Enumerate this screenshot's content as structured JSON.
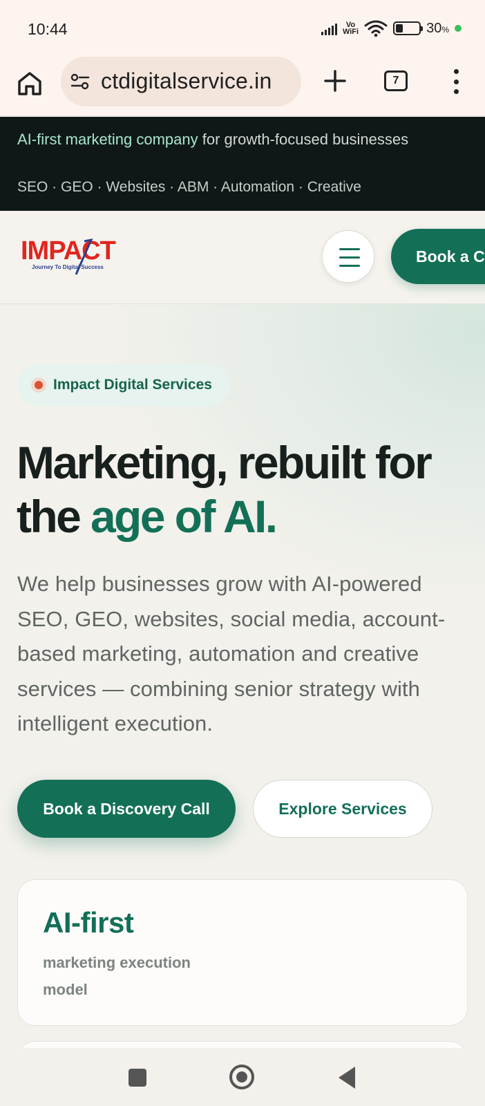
{
  "status_bar": {
    "time": "10:44",
    "network_label_top": "Vo",
    "network_label_bottom": "WiFi",
    "battery_percent": "30",
    "battery_unit": "%",
    "battery_level": 0.3
  },
  "browser": {
    "url": "ctdigitalservice.in",
    "tab_count": "7",
    "icons": [
      "home-icon",
      "site-settings-icon",
      "new-tab-icon",
      "tab-switcher-icon",
      "more-menu-icon"
    ]
  },
  "banner": {
    "highlight": "AI-first marketing company",
    "rest": " for growth-focused businesses",
    "services_line": "SEO · GEO · Websites · ABM · Automation · Creative"
  },
  "header": {
    "logo_text": "IMPACT",
    "logo_tagline": "Journey To Digital Success",
    "cta_label": "Book a Call",
    "menu_icon": "hamburger-icon"
  },
  "hero": {
    "chip_label": "Impact Digital Services",
    "title_part1": "Marketing, rebuilt for the ",
    "title_accent": "age of AI.",
    "description": "We help businesses grow with AI-powered SEO, GEO, websites, social media, account-based marketing, automation and creative services — combining senior strategy with intelligent execution.",
    "primary_button": "Book a Discovery Call",
    "secondary_button": "Explore Services",
    "stat_value": "AI-first",
    "stat_label": "marketing execution model"
  },
  "colors": {
    "brand_green": "#137056",
    "banner_bg": "#0f1817",
    "banner_highlight": "#a9e6cf",
    "chip_dot": "#d9542f",
    "logo_red": "#e0261f"
  }
}
